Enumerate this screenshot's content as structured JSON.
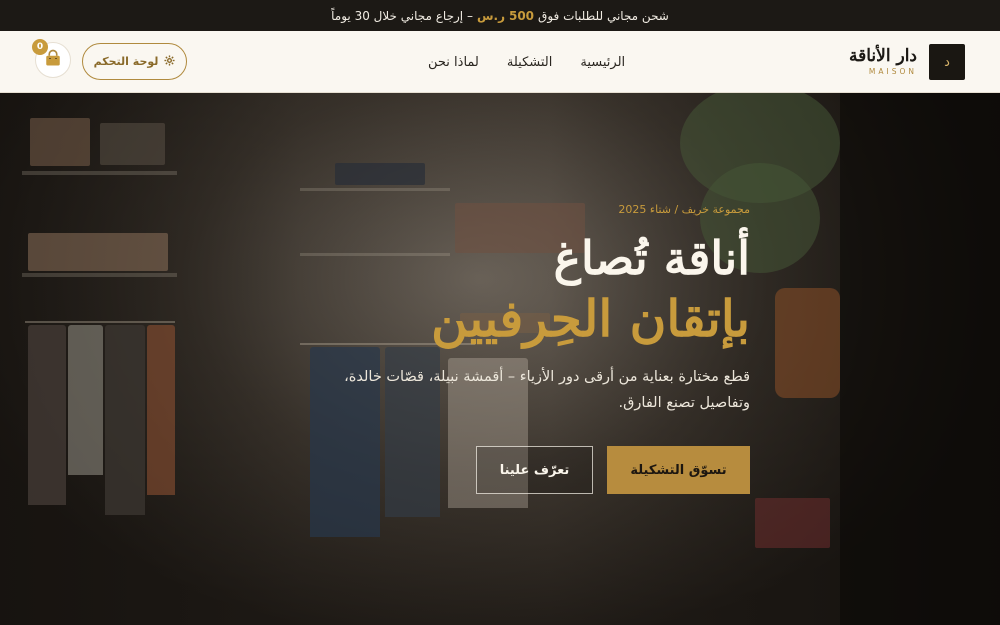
{
  "announcement": {
    "text_before": "شحن مجاني للطلبات فوق",
    "amount": "500",
    "currency": "ر.س",
    "text_after": "– إرجاع مجاني خلال 30 يوماً"
  },
  "brand": {
    "mark": "د",
    "name": "دار الأناقة",
    "sub": "MAISON"
  },
  "nav": {
    "items": [
      "الرئيسية",
      "التشكيلة",
      "لماذا نحن"
    ]
  },
  "header_actions": {
    "dashboard_label": "لوحة التحكم",
    "cart_count": "0"
  },
  "hero": {
    "eyebrow": "مجموعة خريف / شتاء 2025",
    "title_line1": "أناقة تُصاغ",
    "title_line2": "بإتقان الحِرفيين",
    "lead": "قطع مختارة بعناية من أرقى دور الأزياء – أقمشة نبيلة، قصّات خالدة، وتفاصيل تصنع الفارق.",
    "cta_primary": "تسوّق التشكيلة",
    "cta_secondary": "تعرّف علينا"
  },
  "colors": {
    "accent": "#c89b3c",
    "topbar": "#1c1915",
    "header_bg": "#faf7f1"
  },
  "icons": {
    "dashboard": "gear-icon",
    "cart": "shopping-bag-icon"
  }
}
